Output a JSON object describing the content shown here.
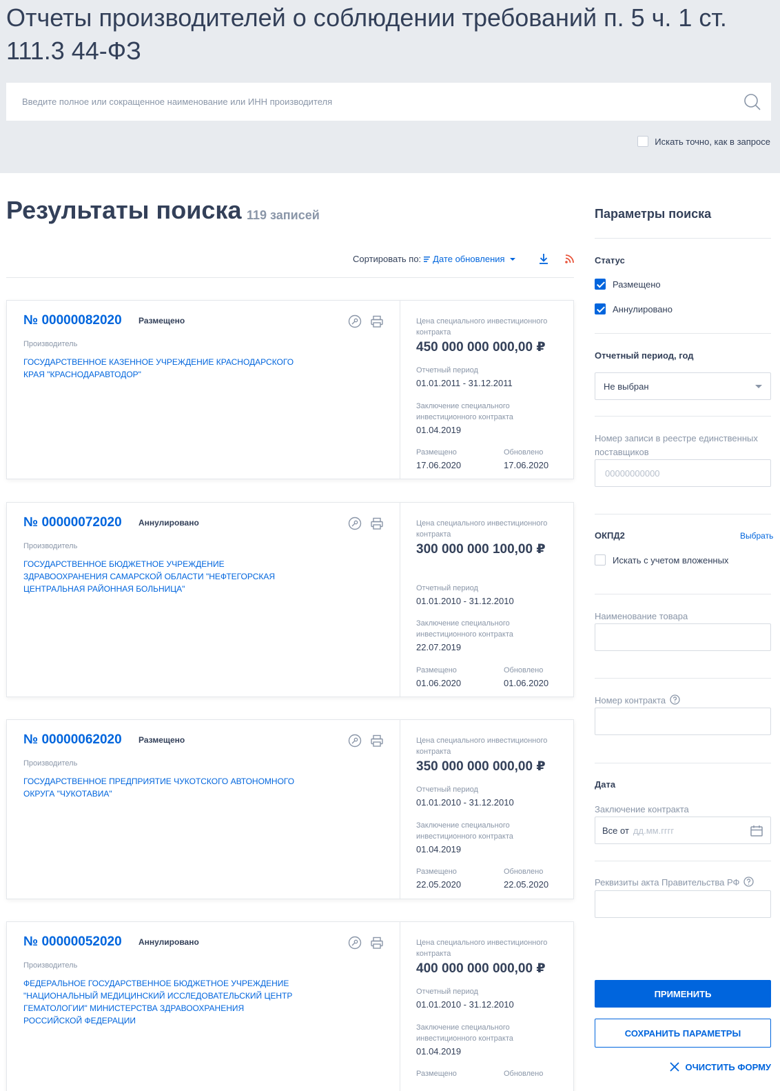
{
  "header": {
    "title": "Отчеты производителей о соблюдении требований п. 5 ч. 1 ст. 111.3 44-ФЗ",
    "search_placeholder": "Введите полное или сокращенное наименование или ИНН производителя",
    "exact_label": "Искать точно, как в запросе"
  },
  "results": {
    "title": "Результаты поиска",
    "count": "119 записей",
    "sort_label": "Сортировать по:",
    "sort_value": "Дате обновления"
  },
  "card_labels": {
    "maker": "Производитель",
    "price": "Цена специального инвестиционного контракта",
    "period": "Отчетный период",
    "conclusion": "Заключение специального инвестиционного контракта",
    "placed": "Размещено",
    "updated": "Обновлено"
  },
  "cards": [
    {
      "number": "№ 00000082020",
      "status": "Размещено",
      "maker": "ГОСУДАРСТВЕННОЕ КАЗЕННОЕ УЧРЕЖДЕНИЕ КРАСНОДАРСКОГО КРАЯ \"КРАСНОДАРАВТОДОР\"",
      "price": "450 000 000 000,00 ₽",
      "period": "01.01.2011 - 31.12.2011",
      "conclusion": "01.04.2019",
      "placed": "17.06.2020",
      "updated": "17.06.2020"
    },
    {
      "number": "№ 00000072020",
      "status": "Аннулировано",
      "maker": "ГОСУДАРСТВЕННОЕ БЮДЖЕТНОЕ УЧРЕЖДЕНИЕ ЗДРАВООХРАНЕНИЯ САМАРСКОЙ ОБЛАСТИ \"НЕФТЕГОРСКАЯ ЦЕНТРАЛЬНАЯ РАЙОННАЯ БОЛЬНИЦА\"",
      "price": "300 000 000 100,00 ₽",
      "period": "01.01.2010 - 31.12.2010",
      "conclusion": "22.07.2019",
      "placed": "01.06.2020",
      "updated": "01.06.2020"
    },
    {
      "number": "№ 00000062020",
      "status": "Размещено",
      "maker": "ГОСУДАРСТВЕННОЕ ПРЕДПРИЯТИЕ ЧУКОТСКОГО АВТОНОМНОГО ОКРУГА \"ЧУКОТАВИА\"",
      "price": "350 000 000 000,00 ₽",
      "period": "01.01.2010 - 31.12.2010",
      "conclusion": "01.04.2019",
      "placed": "22.05.2020",
      "updated": "22.05.2020"
    },
    {
      "number": "№ 00000052020",
      "status": "Аннулировано",
      "maker": "ФЕДЕРАЛЬНОЕ ГОСУДАРСТВЕННОЕ БЮДЖЕТНОЕ УЧРЕЖДЕНИЕ \"НАЦИОНАЛЬНЫЙ МЕДИЦИНСКИЙ ИССЛЕДОВАТЕЛЬСКИЙ ЦЕНТР ГЕМАТОЛОГИИ\" МИНИСТЕРСТВА ЗДРАВООХРАНЕНИЯ РОССИЙСКОЙ ФЕДЕРАЦИИ",
      "price": "400 000 000 000,00 ₽",
      "period": "01.01.2010 - 31.12.2010",
      "conclusion": "01.04.2019"
    }
  ],
  "sidebar": {
    "title": "Параметры поиска",
    "status_heading": "Статус",
    "status_placed": "Размещено",
    "status_cancelled": "Аннулировано",
    "period_heading": "Отчетный период, год",
    "period_value": "Не выбран",
    "registry_label": "Номер записи в реестре единственных поставщиков",
    "registry_placeholder": "00000000000",
    "okpd_heading": "ОКПД2",
    "okpd_choose": "Выбрать",
    "okpd_nested": "Искать с учетом вложенных",
    "product_label": "Наименование товара",
    "contract_label": "Номер контракта",
    "date_heading": "Дата",
    "conclusion_label": "Заключение контракта",
    "date_prefix": "Все от",
    "date_placeholder": "дд.мм.гггг",
    "act_label": "Реквизиты акта Правительства РФ",
    "apply": "ПРИМЕНИТЬ",
    "save": "СОХРАНИТЬ ПАРАМЕТРЫ",
    "clear": "ОЧИСТИТЬ ФОРМУ"
  },
  "colors": {
    "accent": "#0065dd",
    "text": "#334059",
    "muted": "#8a96a8",
    "header_bg": "#e8ebef",
    "rss": "#e8543a"
  }
}
